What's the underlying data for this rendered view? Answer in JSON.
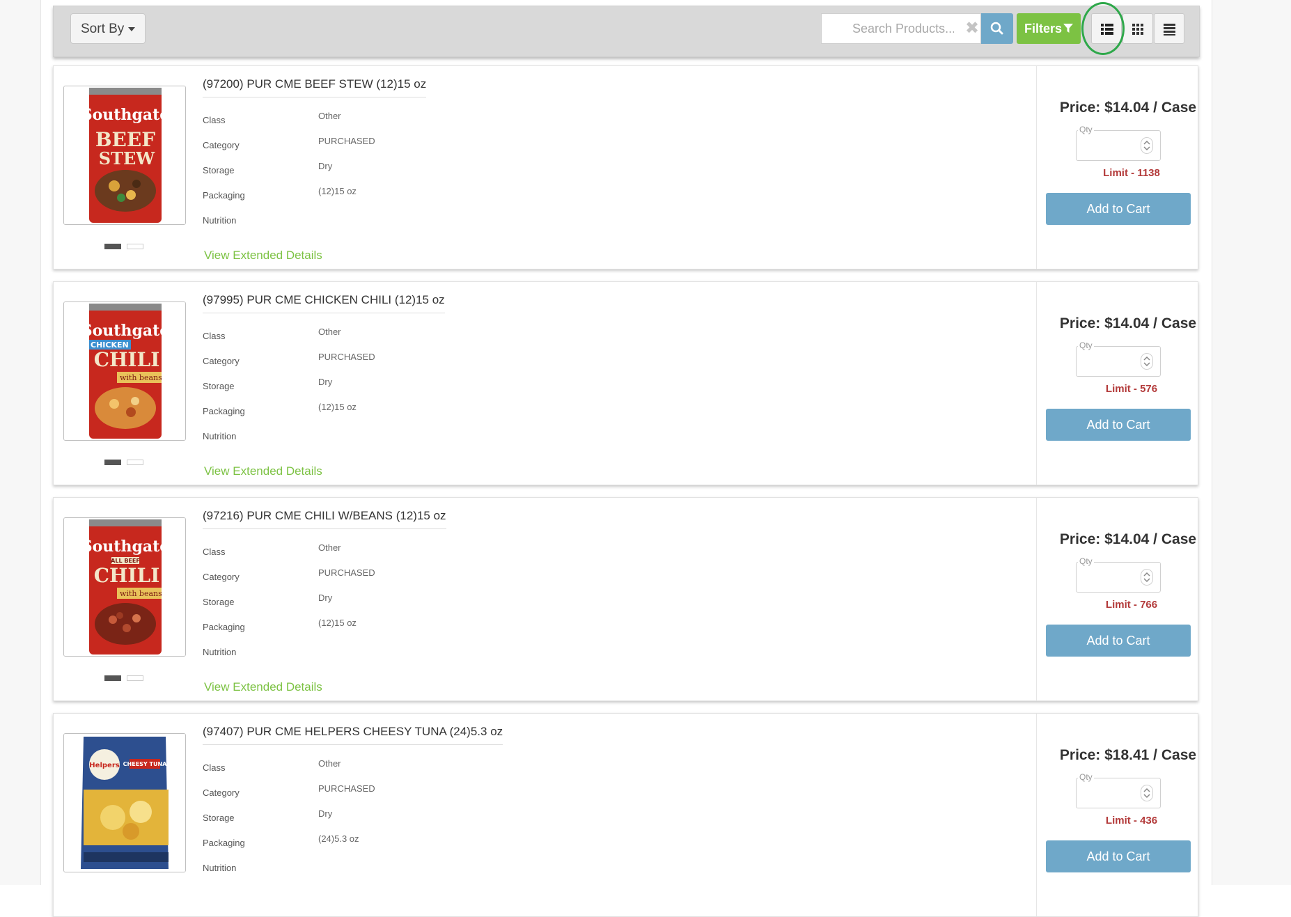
{
  "toolbar": {
    "sort_label": "Sort By",
    "search_placeholder": "Search Products...",
    "filters_label": "Filters"
  },
  "view_modes": [
    "list-detail",
    "grid",
    "list-compact"
  ],
  "highlight": "list-detail",
  "colors": {
    "accent_green": "#7cc243",
    "button_blue": "#6fa8c9",
    "limit_red": "#b33a3a",
    "highlight_ring": "#2ea84a"
  },
  "labels": {
    "class": "Class",
    "category": "Category",
    "storage": "Storage",
    "packaging": "Packaging",
    "nutrition": "Nutrition",
    "qty": "Qty",
    "view_details": "View Extended Details",
    "add_to_cart": "Add to Cart"
  },
  "products": [
    {
      "title": "(97200) PUR CME BEEF STEW (12)15 oz",
      "class": "Other",
      "category": "PURCHASED",
      "storage": "Dry",
      "packaging": "(12)15 oz",
      "price": "Price: $14.04 / Case",
      "limit": "Limit - 1138",
      "image_label": "Southgate BEEF STEW"
    },
    {
      "title": "(97995) PUR CME CHICKEN CHILI (12)15 oz",
      "class": "Other",
      "category": "PURCHASED",
      "storage": "Dry",
      "packaging": "(12)15 oz",
      "price": "Price: $14.04 / Case",
      "limit": "Limit - 576",
      "image_label": "Southgate CHICKEN CHILI with beans"
    },
    {
      "title": "(97216) PUR CME CHILI W/BEANS (12)15 oz",
      "class": "Other",
      "category": "PURCHASED",
      "storage": "Dry",
      "packaging": "(12)15 oz",
      "price": "Price: $14.04 / Case",
      "limit": "Limit - 766",
      "image_label": "Southgate ALL BEEF CHILI with beans"
    },
    {
      "title": "(97407) PUR CME HELPERS CHEESY TUNA (24)5.3 oz",
      "class": "Other",
      "category": "PURCHASED",
      "storage": "Dry",
      "packaging": "(24)5.3 oz",
      "price": "Price: $18.41 / Case",
      "limit": "Limit - 436",
      "image_label": "Cheesy Tuna helper pouch"
    }
  ]
}
